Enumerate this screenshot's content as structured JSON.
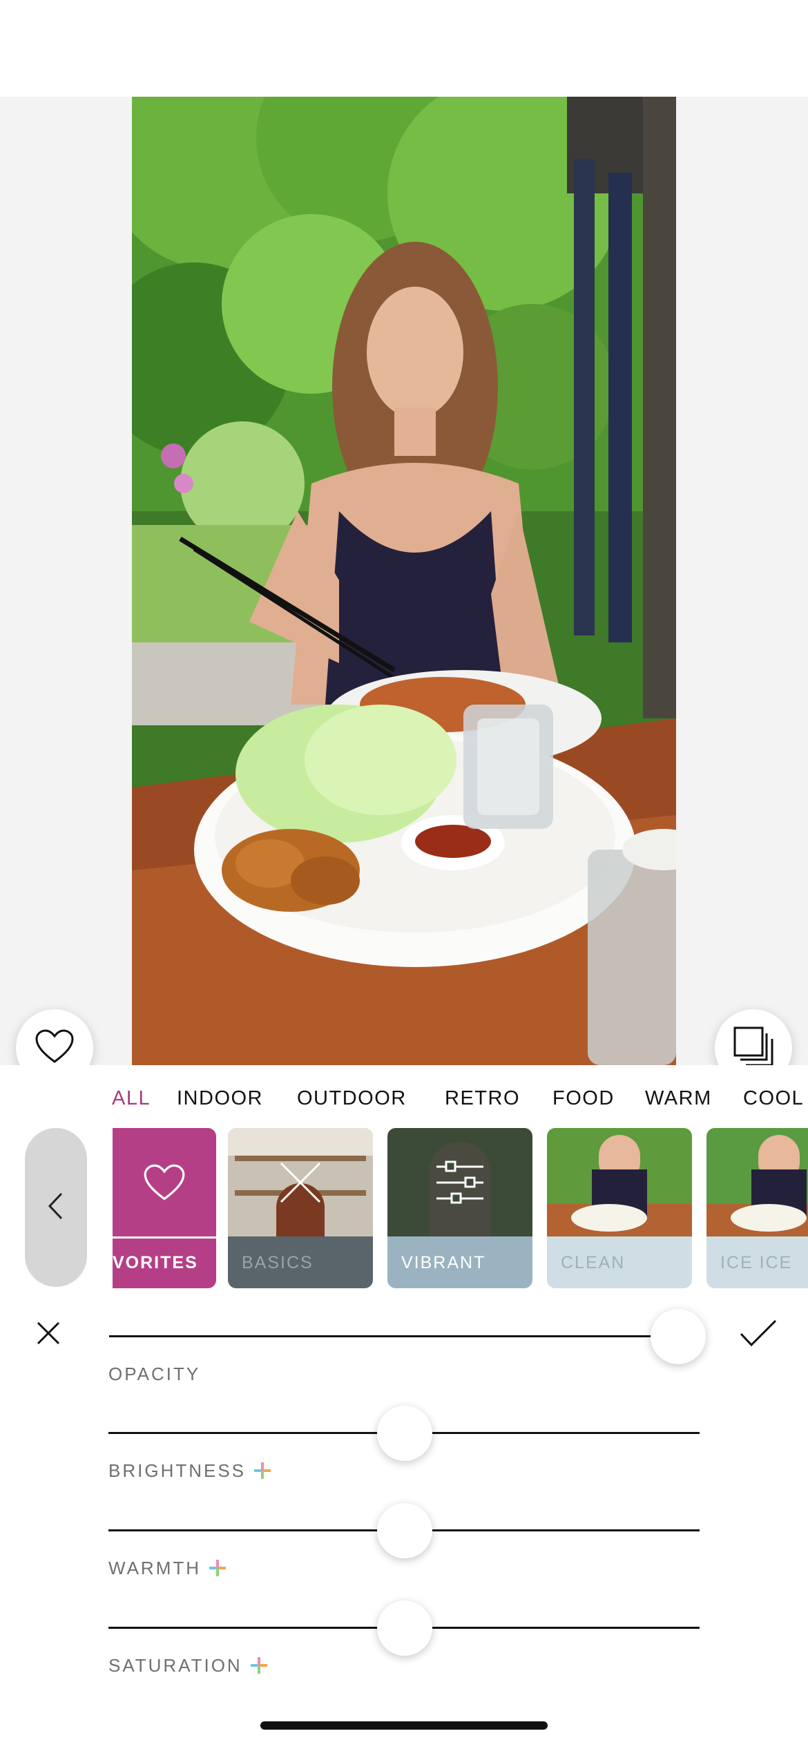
{
  "photo": {
    "alt": "Edited photo preview"
  },
  "actions": {
    "favorite_icon": "heart-icon",
    "layers_icon": "layers-icon",
    "cancel_icon": "close-icon",
    "apply_icon": "checkmark-icon",
    "back_icon": "chevron-left-icon"
  },
  "tabs": [
    {
      "label": "ALL",
      "active": true
    },
    {
      "label": "INDOOR",
      "active": false
    },
    {
      "label": "OUTDOOR",
      "active": false
    },
    {
      "label": "RETRO",
      "active": false
    },
    {
      "label": "FOOD",
      "active": false
    },
    {
      "label": "WARM",
      "active": false
    },
    {
      "label": "COOL",
      "active": false
    }
  ],
  "filters": [
    {
      "label": "VORITES",
      "icon": "heart-icon",
      "color": "#b53f86"
    },
    {
      "label": "BASICS",
      "icon": "x-icon",
      "color": "#5a646b"
    },
    {
      "label": "VIBRANT",
      "icon": "sliders-icon",
      "color": "#9bb3c0"
    },
    {
      "label": "CLEAN",
      "icon": "",
      "color": "#cfdde4"
    },
    {
      "label": "ICE ICE",
      "icon": "",
      "color": "#cfdde4"
    }
  ],
  "sliders": {
    "opacity": {
      "label": "OPACITY",
      "value_pct": 100
    },
    "brightness": {
      "label": "BRIGHTNESS",
      "value_pct": 50,
      "premium_icon": "plus-icon"
    },
    "warmth": {
      "label": "WARMTH",
      "value_pct": 50,
      "premium_icon": "plus-icon"
    },
    "saturation": {
      "label": "SATURATION",
      "value_pct": 50,
      "premium_icon": "plus-icon"
    }
  },
  "colors": {
    "accent": "#a83a7d",
    "favorites": "#b53f86"
  }
}
